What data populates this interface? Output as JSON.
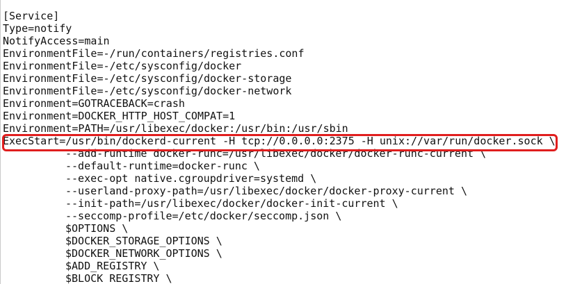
{
  "editor": {
    "lines": [
      {
        "text": "[Service]",
        "indent": false
      },
      {
        "text": "Type=notify",
        "indent": false
      },
      {
        "text": "NotifyAccess=main",
        "indent": false
      },
      {
        "text": "EnvironmentFile=-/run/containers/registries.conf",
        "indent": false
      },
      {
        "text": "EnvironmentFile=-/etc/sysconfig/docker",
        "indent": false
      },
      {
        "text": "EnvironmentFile=-/etc/sysconfig/docker-storage",
        "indent": false
      },
      {
        "text": "EnvironmentFile=-/etc/sysconfig/docker-network",
        "indent": false
      },
      {
        "text": "Environment=GOTRACEBACK=crash",
        "indent": false
      },
      {
        "text": "Environment=DOCKER_HTTP_HOST_COMPAT=1",
        "indent": false
      },
      {
        "text": "Environment=PATH=/usr/libexec/docker:/usr/bin:/usr/sbin",
        "indent": false
      },
      {
        "text": "ExecStart=/usr/bin/dockerd-current -H tcp://0.0.0.0:2375 -H unix://var/run/docker.sock \\",
        "indent": false
      },
      {
        "text": "--add-runtime docker-runc=/usr/libexec/docker/docker-runc-current \\",
        "indent": true
      },
      {
        "text": "--default-runtime=docker-runc \\",
        "indent": true
      },
      {
        "text": "--exec-opt native.cgroupdriver=systemd \\",
        "indent": true
      },
      {
        "text": "--userland-proxy-path=/usr/libexec/docker/docker-proxy-current \\",
        "indent": true
      },
      {
        "text": "--init-path=/usr/libexec/docker/docker-init-current \\",
        "indent": true
      },
      {
        "text": "--seccomp-profile=/etc/docker/seccomp.json \\",
        "indent": true
      },
      {
        "text": "$OPTIONS \\",
        "indent": true
      },
      {
        "text": "$DOCKER_STORAGE_OPTIONS \\",
        "indent": true
      },
      {
        "text": "$DOCKER_NETWORK_OPTIONS \\",
        "indent": true
      },
      {
        "text": "$ADD_REGISTRY \\",
        "indent": true
      },
      {
        "text": "$BLOCK_REGISTRY \\",
        "indent": true
      }
    ],
    "highlighted_line": 10,
    "colors": {
      "text": "#111111",
      "background": "#ffffff",
      "highlight_border": "#e01e1e"
    }
  }
}
